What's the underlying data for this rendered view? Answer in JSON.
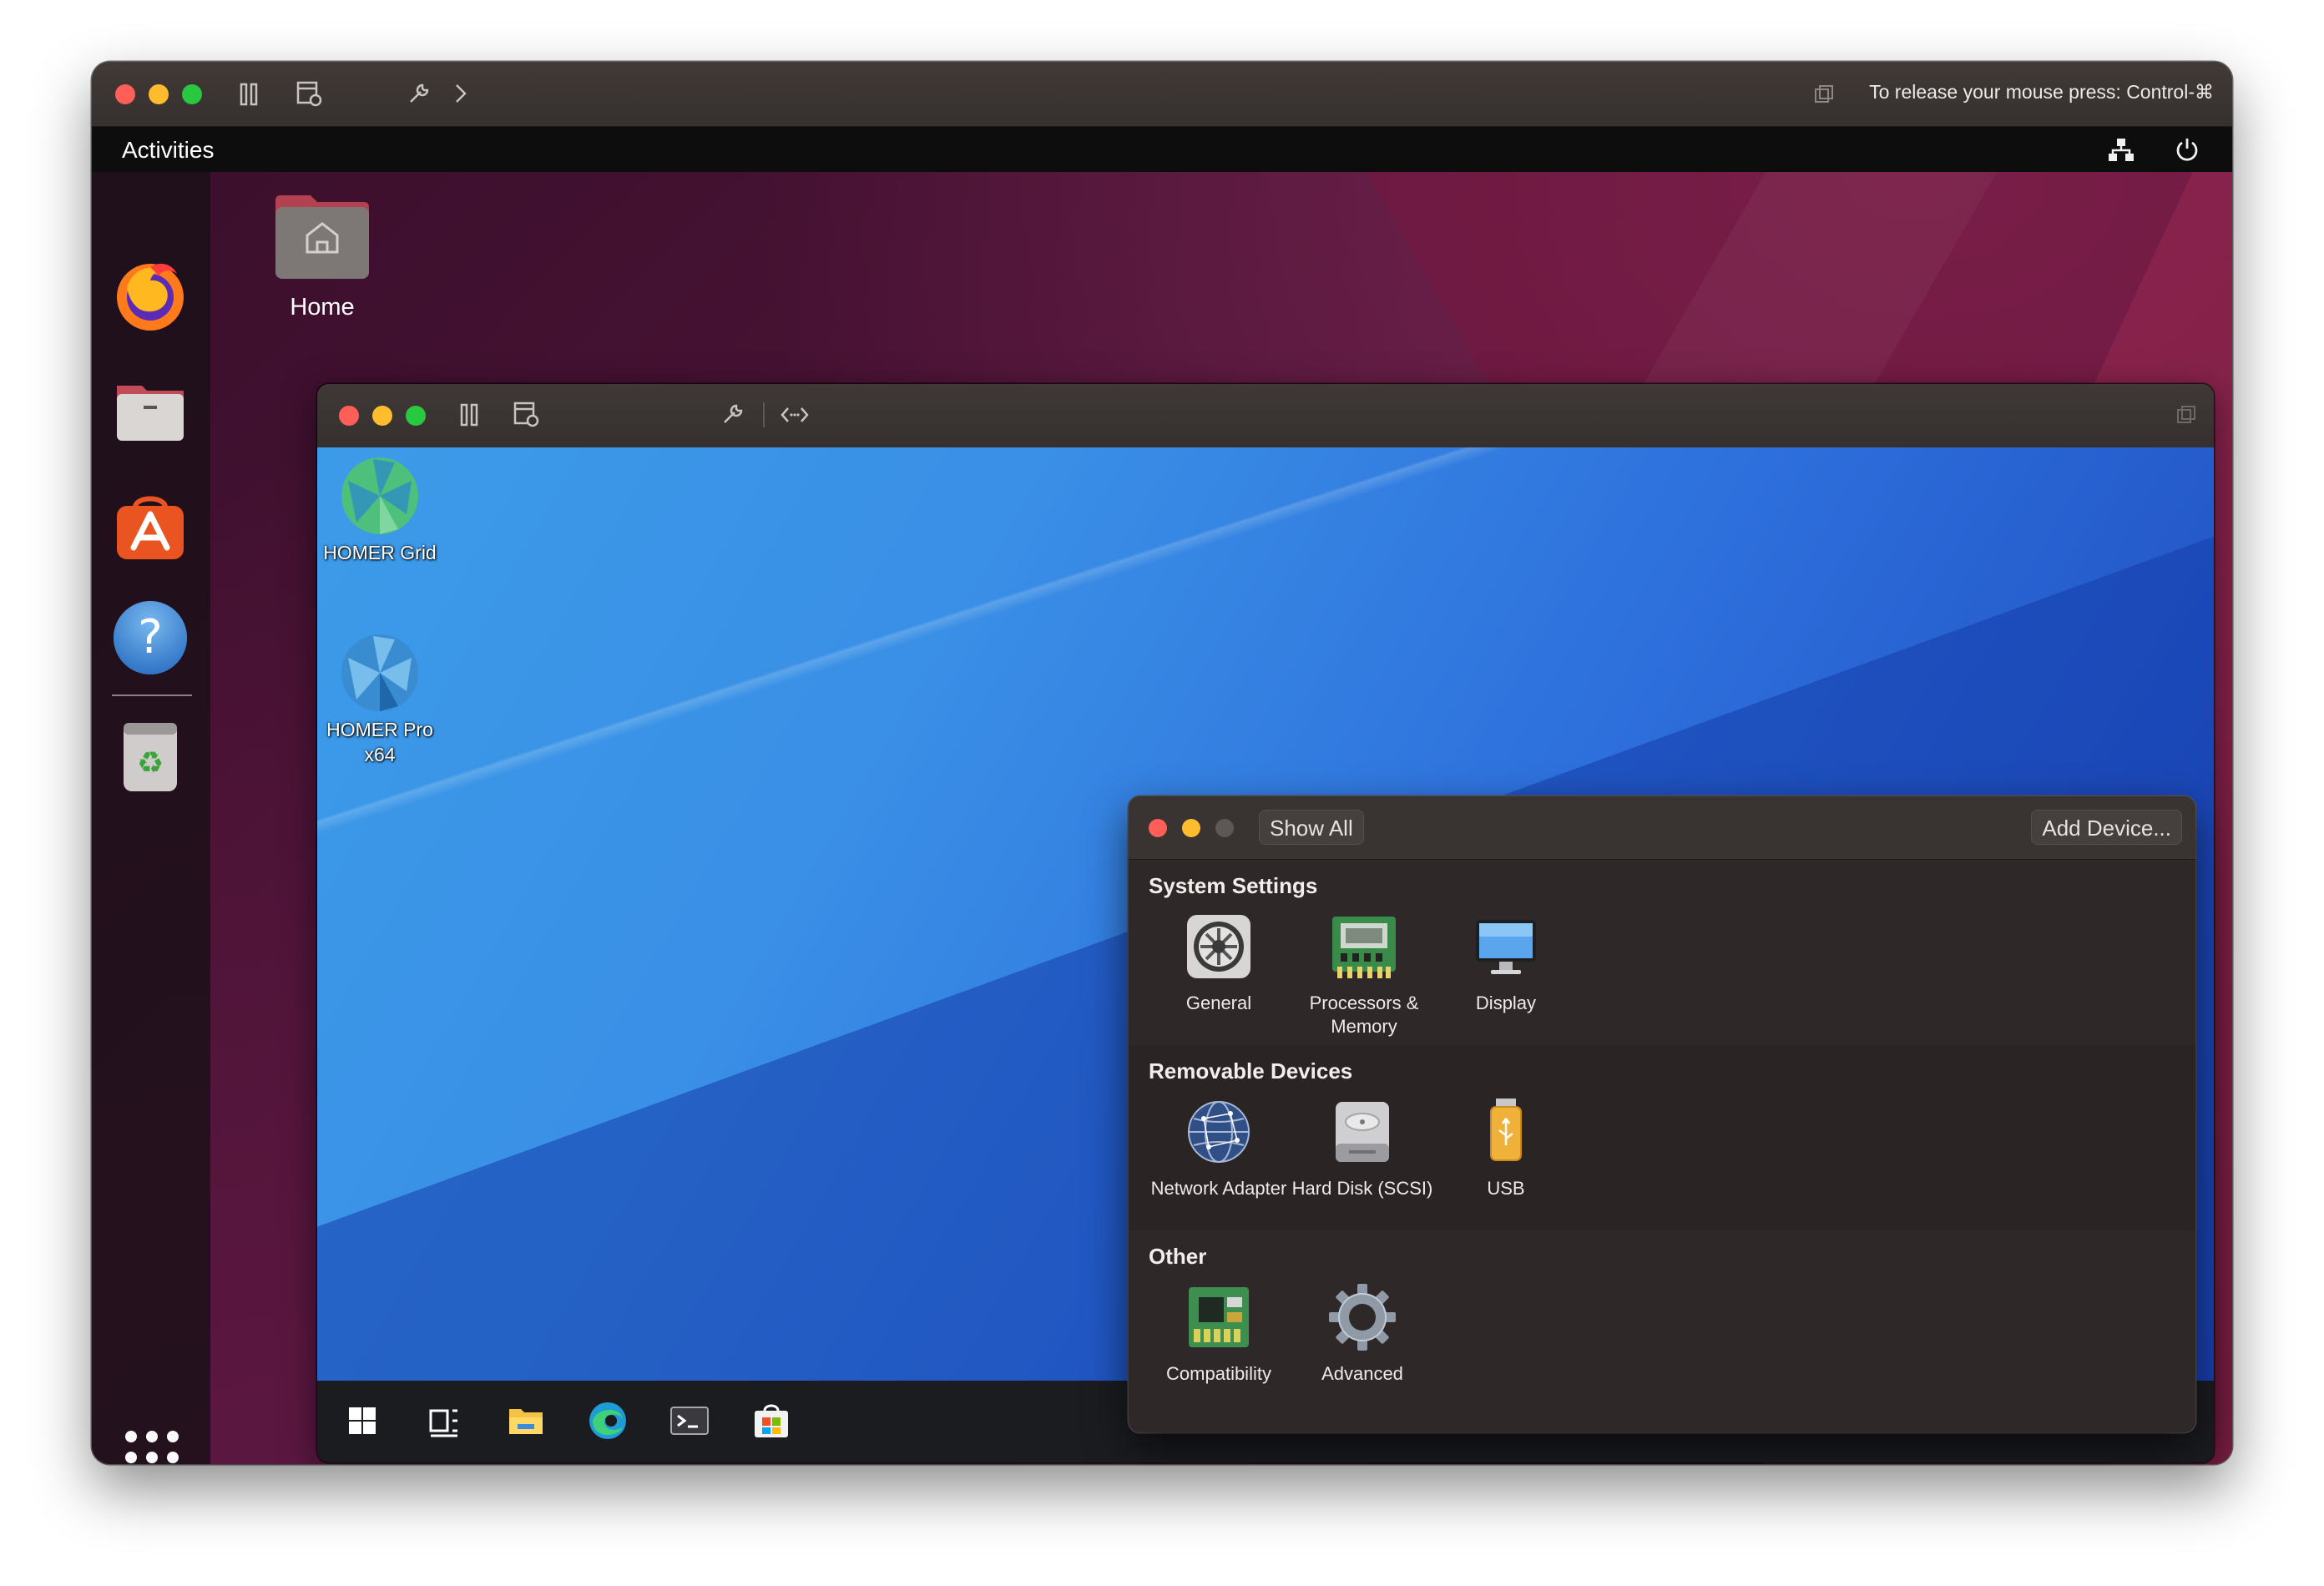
{
  "outer_window": {
    "release_hint": "To release your mouse press: Control-⌘"
  },
  "ubuntu": {
    "activities": "Activities",
    "home_label": "Home",
    "dock_apps": [
      "firefox",
      "files",
      "app-center",
      "help",
      "trash"
    ]
  },
  "windows_guest": {
    "desktop_icons": [
      {
        "label": "HOMER Grid"
      },
      {
        "label": "HOMER Pro x64"
      }
    ],
    "taskbar": [
      "start",
      "task-view",
      "file-explorer",
      "edge",
      "terminal",
      "store"
    ]
  },
  "settings": {
    "show_all": "Show All",
    "add_device": "Add Device...",
    "sections": [
      {
        "title": "System Settings",
        "items": [
          {
            "label": "General",
            "icon": "general-icon"
          },
          {
            "label": "Processors & Memory",
            "icon": "processor-icon"
          },
          {
            "label": "Display",
            "icon": "display-icon"
          }
        ]
      },
      {
        "title": "Removable Devices",
        "items": [
          {
            "label": "Network Adapter",
            "icon": "network-icon"
          },
          {
            "label": "Hard Disk (SCSI)",
            "icon": "hard-disk-icon"
          },
          {
            "label": "USB",
            "icon": "usb-icon"
          }
        ]
      },
      {
        "title": "Other",
        "items": [
          {
            "label": "Compatibility",
            "icon": "compatibility-icon"
          },
          {
            "label": "Advanced",
            "icon": "advanced-icon"
          }
        ]
      }
    ]
  }
}
